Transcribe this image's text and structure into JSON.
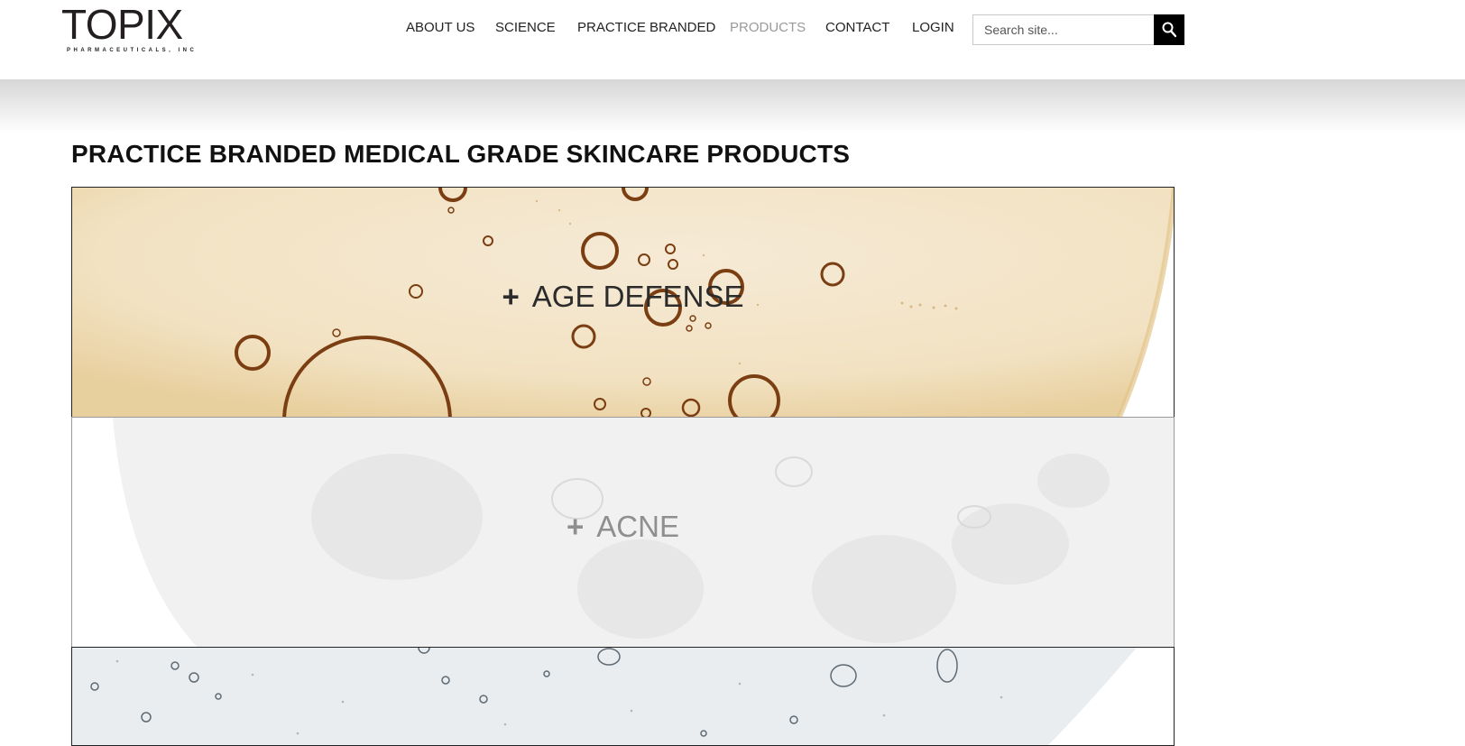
{
  "logo": {
    "wordmark": "TOPIX",
    "subtitle": "PHARMACEUTICALS, INC"
  },
  "nav": {
    "items": [
      {
        "label": "ABOUT US"
      },
      {
        "label": "SCIENCE"
      },
      {
        "label": "PRACTICE BRANDED"
      },
      {
        "label": "PRODUCTS",
        "active": true
      },
      {
        "label": "CONTACT"
      },
      {
        "label": "LOGIN"
      }
    ]
  },
  "search": {
    "placeholder": "Search site...",
    "value": ""
  },
  "page": {
    "title": "PRACTICE BRANDED MEDICAL GRADE SKINCARE PRODUCTS"
  },
  "categories": [
    {
      "label": "AGE DEFENSE",
      "toggle": "+",
      "color": "#2b2b2b"
    },
    {
      "label": "ACNE",
      "toggle": "+",
      "color": "#8f8f8f"
    },
    {
      "label": "",
      "toggle": ""
    }
  ],
  "colors": {
    "accent_active_nav": "#9a9a9a",
    "search_button": "#000000",
    "text": "#111111"
  }
}
